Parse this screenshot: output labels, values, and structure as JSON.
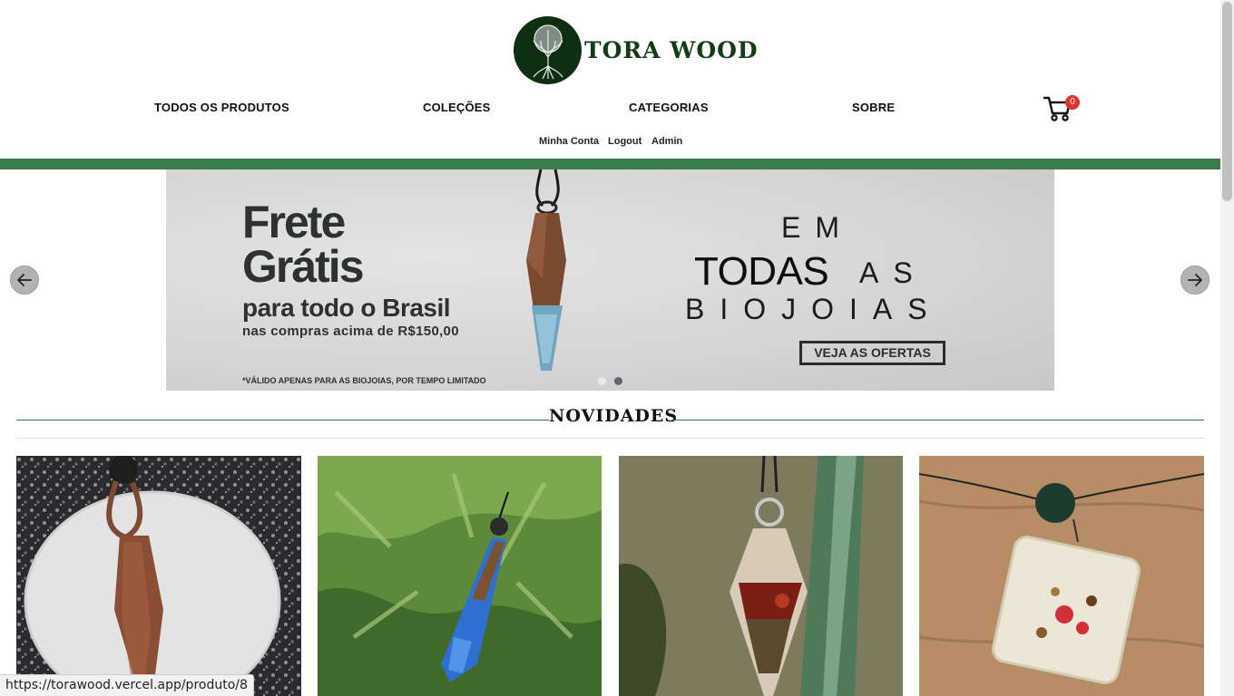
{
  "header": {
    "brand_name": "TORA WOOD",
    "logo_icon": "tree-of-life-icon",
    "nav": [
      "TODOS OS PRODUTOS",
      "COLEÇÕES",
      "CATEGORIAS",
      "SOBRE"
    ],
    "cart_icon": "shopping-cart-icon",
    "cart_count": "0",
    "sub_nav": [
      "Minha Conta",
      "Logout",
      "Admin"
    ],
    "accent_color": "#3b7d4c"
  },
  "banner": {
    "line1": "Frete",
    "line2": "Grátis",
    "line3": "para todo o Brasil",
    "line4": "nas compras acima de R$150,00",
    "disclaimer": "*VÁLIDO APENAS PARA AS BIOJOIAS, POR TEMPO LIMITADO",
    "em": "EM",
    "todas": "TODAS",
    "as": "AS",
    "biojoias": "BIOJOIAS",
    "cta": "VEJA AS OFERTAS",
    "slides": 2,
    "active_slide": 2,
    "prev_icon": "arrow-left-icon",
    "next_icon": "arrow-right-icon"
  },
  "section": {
    "title": "NOVIDADES"
  },
  "products": [
    {
      "image": "wooden-pendant-on-white-stone"
    },
    {
      "image": "blue-resin-pendant-on-leaves"
    },
    {
      "image": "red-resin-crystal-pendant"
    },
    {
      "image": "clear-resin-square-pendant"
    }
  ],
  "status_bar": {
    "url": "https://torawood.vercel.app/produto/8"
  }
}
